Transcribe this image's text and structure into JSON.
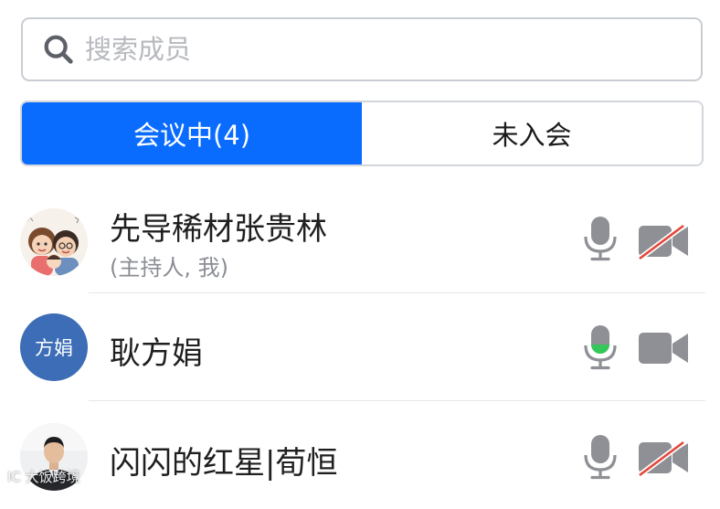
{
  "search": {
    "placeholder": "搜索成员"
  },
  "tabs": [
    {
      "label": "会议中(4)",
      "active": true
    },
    {
      "label": "未入会",
      "active": false
    }
  ],
  "members": [
    {
      "name": "先导稀材张贵林",
      "role": "(主持人, 我)",
      "avatar": "cartoon-family-avatar",
      "mic": "idle",
      "camera": "off"
    },
    {
      "name": "耿方娟",
      "avatar_text": "方娟",
      "avatar_color": "#3c6db6",
      "mic": "speaking",
      "camera": "on"
    },
    {
      "name": "闪闪的红星|荀恒",
      "avatar": "man-in-suit-photo",
      "mic": "idle",
      "camera": "off"
    }
  ],
  "colors": {
    "accent": "#0a6cff",
    "icon_gray": "#8e9095",
    "camera_off_slash": "#e5473c",
    "speaking_green": "#35c759"
  },
  "watermark": "IC 大饭跨境"
}
